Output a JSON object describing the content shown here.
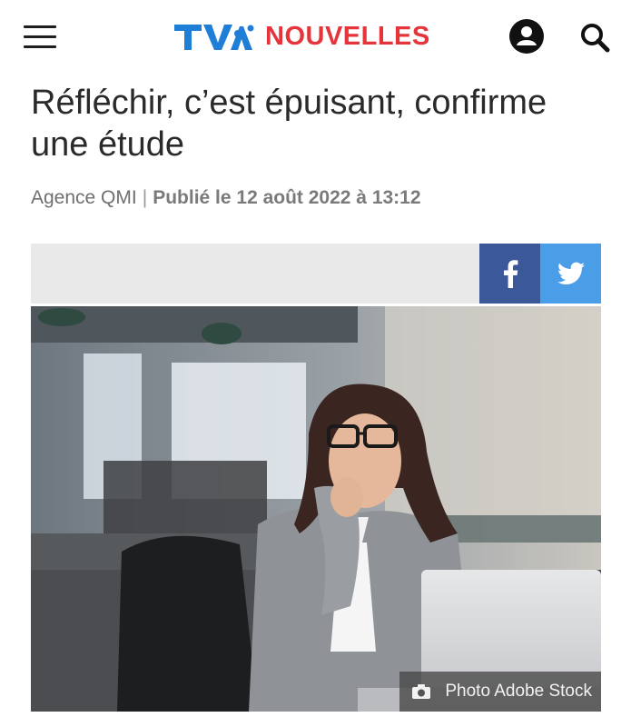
{
  "header": {
    "logo_brand": "TVA",
    "logo_section": "NOUVELLES",
    "colors": {
      "tva_blue": "#1f7fd6",
      "accent_red": "#e5343a"
    },
    "icons": [
      "menu-icon",
      "account-icon",
      "search-icon"
    ]
  },
  "article": {
    "title": "Réfléchir, c’est épuisant, confirme une étude",
    "author": "Agence QMI",
    "separator": "|",
    "published": "Publié le 12 août 2022 à 13:12"
  },
  "share": {
    "facebook_icon": "facebook-icon",
    "twitter_icon": "twitter-icon",
    "colors": {
      "facebook": "#3b5998",
      "twitter": "#4a9ee8",
      "bar": "#e9e9e9"
    }
  },
  "media": {
    "image_alt": "Woman with glasses thinking at a desk in front of a laptop",
    "credit": "Photo Adobe Stock",
    "credit_icon": "camera-icon"
  }
}
